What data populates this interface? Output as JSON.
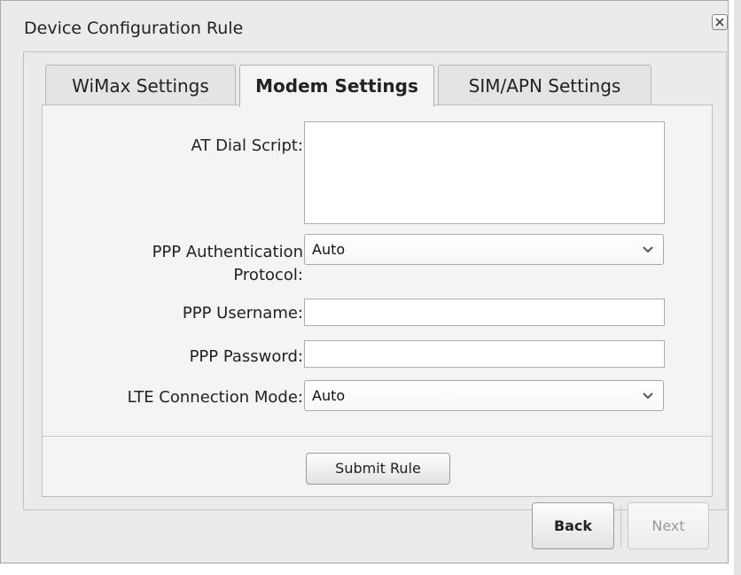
{
  "dialog": {
    "title": "Device Configuration Rule",
    "close_icon": "close-icon"
  },
  "tabs": [
    {
      "label": "WiMax Settings",
      "active": false
    },
    {
      "label": "Modem Settings",
      "active": true
    },
    {
      "label": "SIM/APN Settings",
      "active": false
    }
  ],
  "form": {
    "at_dial_script": {
      "label": "AT Dial Script:",
      "value": ""
    },
    "ppp_auth_protocol": {
      "label_line1": "PPP Authentication",
      "label_line2": "Protocol:",
      "selected": "Auto"
    },
    "ppp_username": {
      "label": "PPP Username:",
      "value": ""
    },
    "ppp_password": {
      "label": "PPP Password:",
      "value": ""
    },
    "lte_connection_mode": {
      "label": "LTE Connection Mode:",
      "selected": "Auto"
    }
  },
  "buttons": {
    "submit": "Submit Rule",
    "back": "Back",
    "next": "Next"
  },
  "colors": {
    "dialog_bg": "#ebebeb",
    "panel_bg": "#f4f4f4",
    "disabled_text": "#9a9a9a"
  }
}
